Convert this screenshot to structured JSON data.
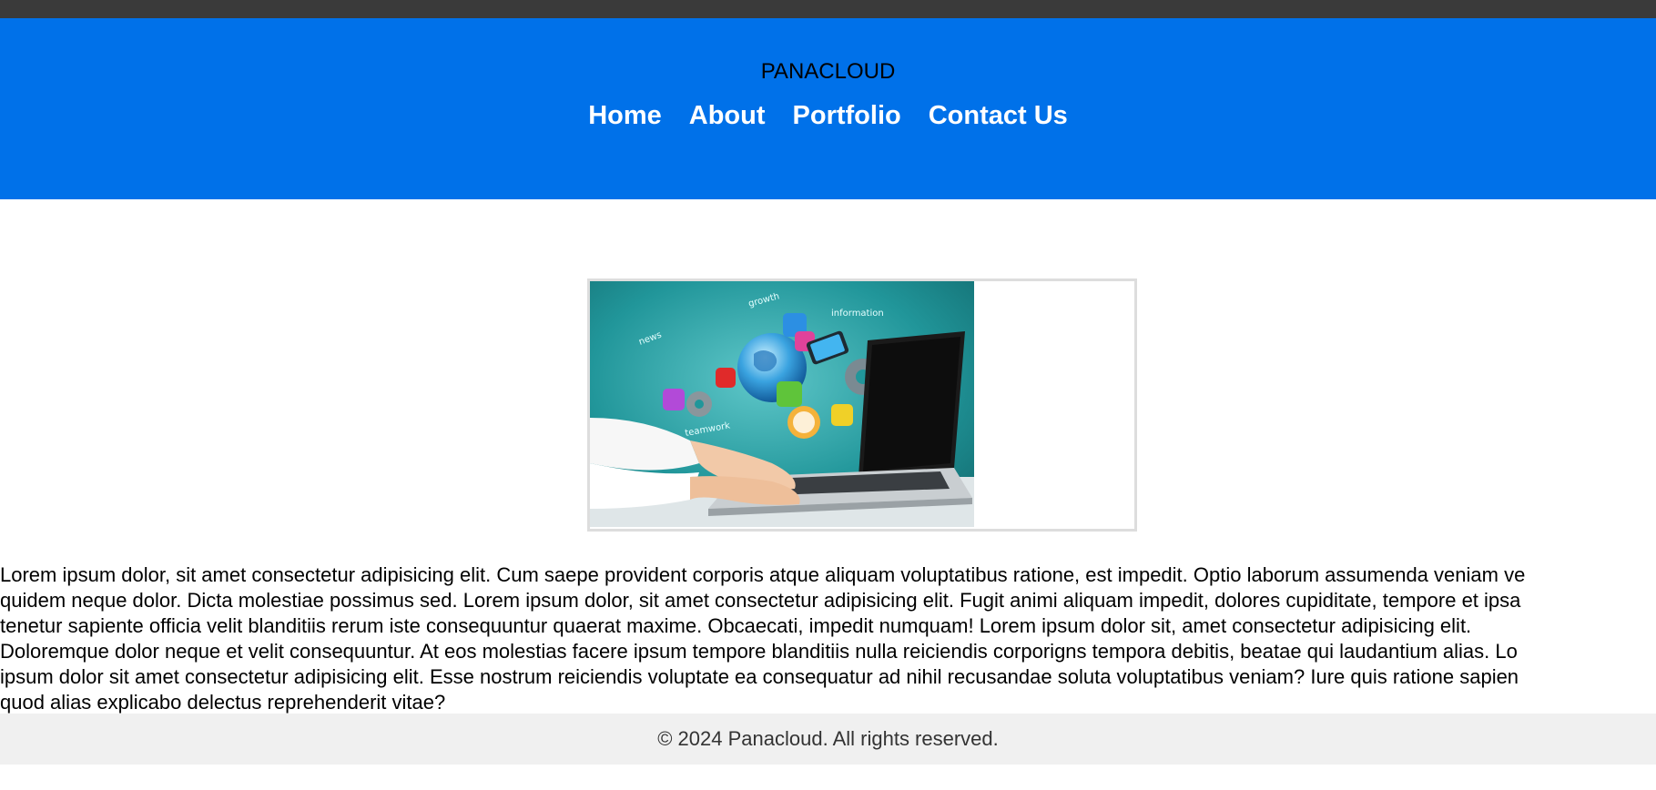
{
  "header": {
    "brand": "PANACLOUD",
    "nav": [
      "Home",
      "About",
      "Portfolio",
      "Contact Us"
    ]
  },
  "hero_image": {
    "words": [
      "news",
      "growth",
      "information",
      "teamwork"
    ]
  },
  "content": {
    "lines": [
      "Lorem ipsum dolor, sit amet consectetur adipisicing elit. Cum saepe provident corporis atque aliquam voluptatibus ratione, est impedit. Optio laborum assumenda veniam ve",
      "quidem neque dolor. Dicta molestiae possimus sed. Lorem ipsum dolor, sit amet consectetur adipisicing elit. Fugit animi aliquam impedit, dolores cupiditate, tempore et ipsa",
      "tenetur sapiente officia velit blanditiis rerum iste consequuntur quaerat maxime. Obcaecati, impedit numquam! Lorem ipsum dolor sit, amet consectetur adipisicing elit.",
      "Doloremque dolor neque et velit consequuntur. At eos molestias facere ipsum tempore blanditiis nulla reiciendis corporigns tempora debitis, beatae qui laudantium alias. Lo",
      "ipsum dolor sit amet consectetur adipisicing elit. Esse nostrum reiciendis voluptate ea consequatur ad nihil recusandae soluta voluptatibus veniam? Iure quis ratione sapien",
      "quod alias explicabo delectus reprehenderit vitae?"
    ]
  },
  "footer": {
    "text": "© 2024 Panacloud. All rights reserved."
  },
  "colors": {
    "header_bg": "#0071e9",
    "topbar_bg": "#3a3a3a",
    "footer_bg": "#f0f0f0"
  }
}
